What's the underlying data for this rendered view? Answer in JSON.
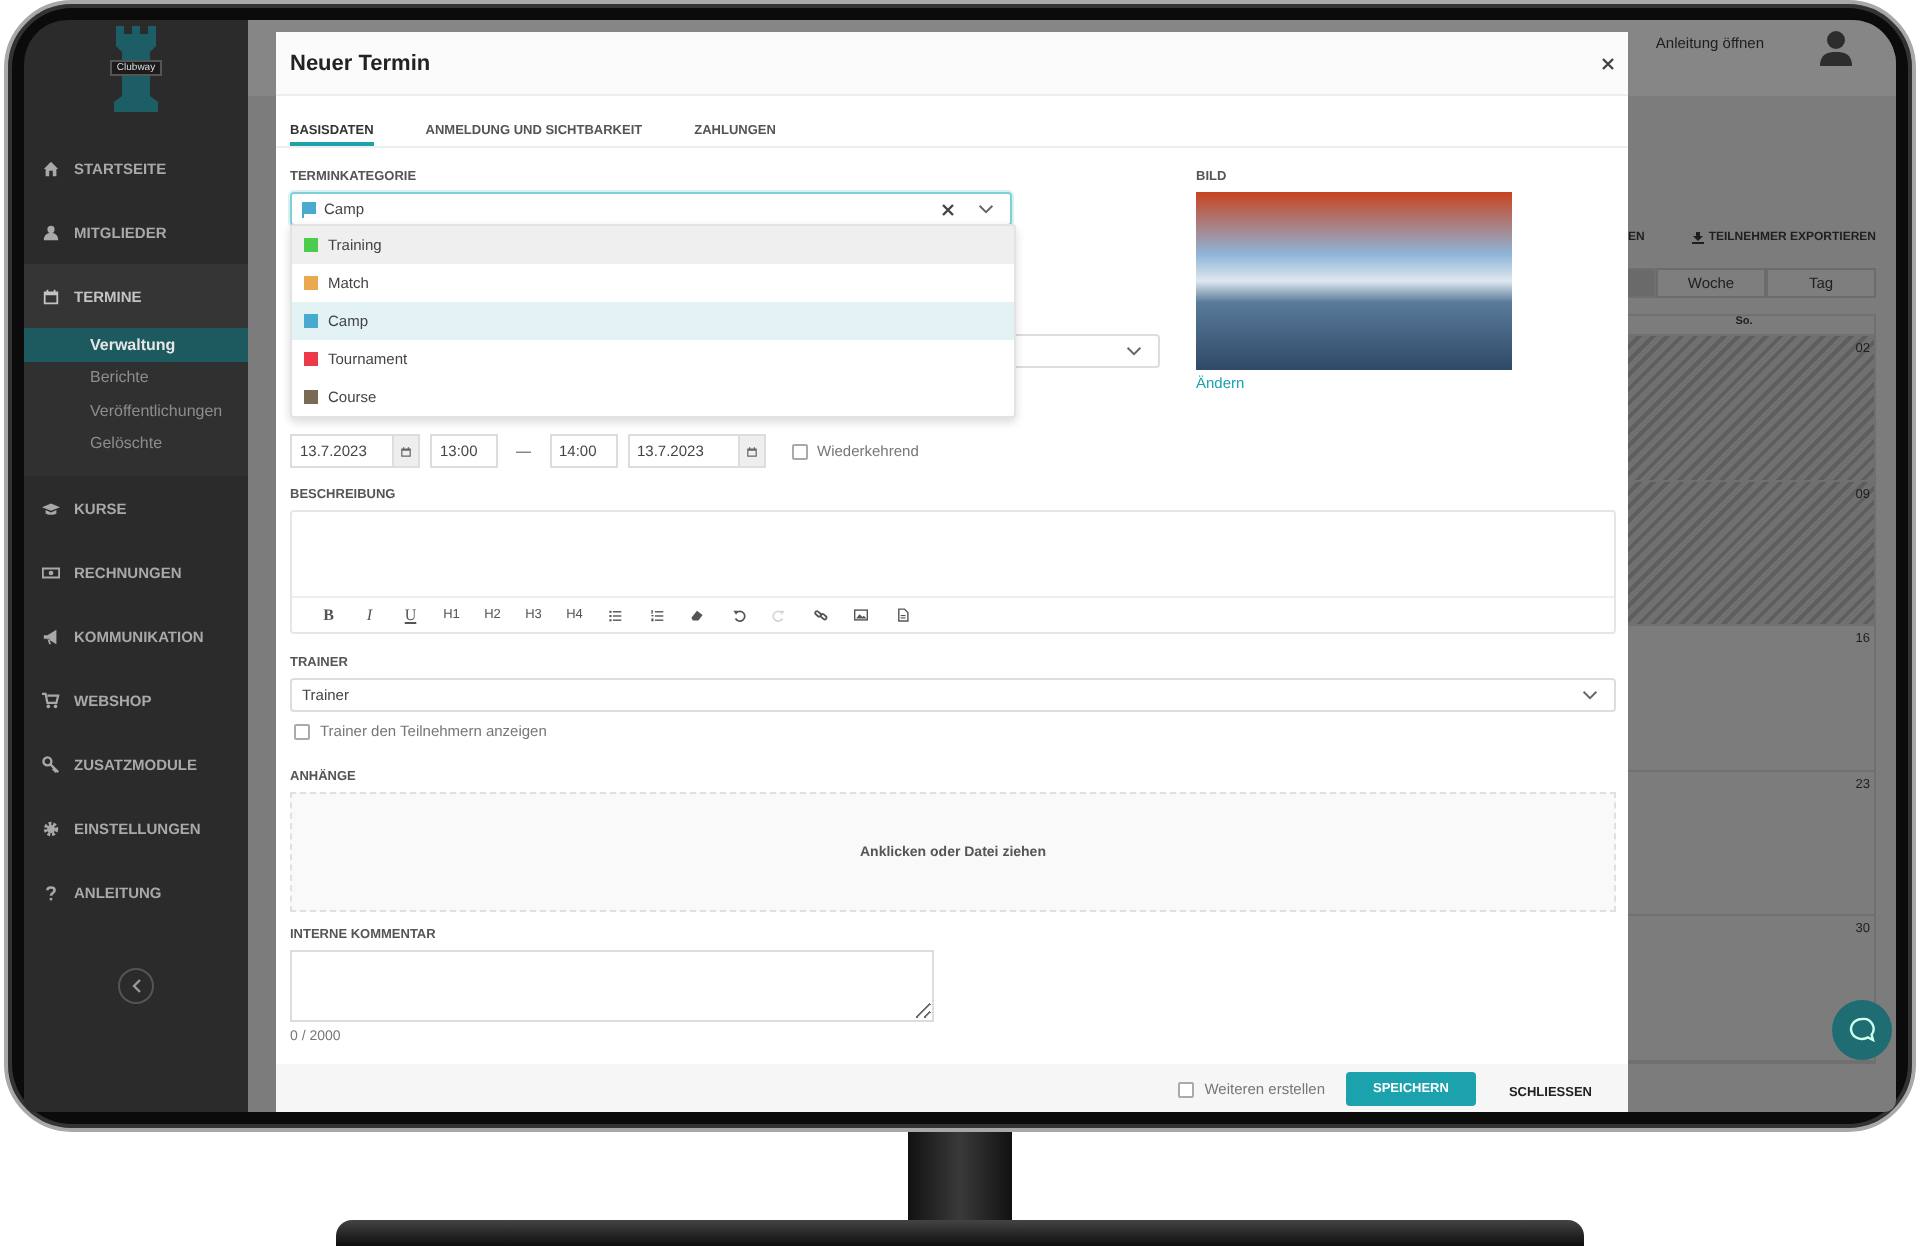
{
  "sidebar": {
    "logo_text": "Clubway",
    "items": [
      {
        "label": "STARTSEITE",
        "expanded": false
      },
      {
        "label": "MITGLIEDER",
        "expanded": false
      },
      {
        "label": "TERMINE",
        "expanded": true,
        "children": [
          {
            "label": "Verwaltung",
            "selected": true
          },
          {
            "label": "Berichte",
            "selected": false
          },
          {
            "label": "Veröffentlichungen",
            "selected": false
          },
          {
            "label": "Gelöschte",
            "selected": false
          }
        ]
      },
      {
        "label": "KURSE",
        "expanded": false
      },
      {
        "label": "RECHNUNGEN",
        "expanded": false
      },
      {
        "label": "KOMMUNIKATION",
        "expanded": false
      },
      {
        "label": "WEBSHOP",
        "expanded": false
      },
      {
        "label": "ZUSATZMODULE",
        "expanded": false
      },
      {
        "label": "EINSTELLUNGEN",
        "expanded": false
      },
      {
        "label": "ANLEITUNG",
        "expanded": false
      }
    ]
  },
  "topbar": {
    "help_link": "Anleitung öffnen"
  },
  "background": {
    "toolbar": [
      "EN",
      "TEILNEHMER EXPORTIEREN"
    ],
    "views": [
      {
        "label": "Woche",
        "selected": false
      },
      {
        "label": "Tag",
        "selected": false
      }
    ],
    "calendar": {
      "column": "So.",
      "days": [
        {
          "label": "02",
          "past": true
        },
        {
          "label": "09",
          "past": true
        },
        {
          "label": "16",
          "past": false
        },
        {
          "label": "23",
          "past": false
        },
        {
          "label": "30",
          "past": false
        }
      ]
    }
  },
  "dialog": {
    "title": "Neuer Termin",
    "tabs": [
      {
        "label": "BASISDATEN",
        "selected": true
      },
      {
        "label": "ANMELDUNG UND SICHTBARKEIT",
        "selected": false
      },
      {
        "label": "ZAHLUNGEN",
        "selected": false
      }
    ],
    "category": {
      "label": "TERMINKATEGORIE",
      "value": "Camp",
      "color": "#4aa9cf",
      "options": [
        {
          "label": "Training",
          "color": "#4ccc4c",
          "selected": false,
          "hovered": true
        },
        {
          "label": "Match",
          "color": "#eaa94e",
          "selected": false,
          "hovered": false
        },
        {
          "label": "Camp",
          "color": "#4aa9cf",
          "selected": true,
          "hovered": false
        },
        {
          "label": "Tournament",
          "color": "#ec3a48",
          "selected": false,
          "hovered": false
        },
        {
          "label": "Course",
          "color": "#7a6a55",
          "selected": false,
          "hovered": false
        }
      ]
    },
    "image": {
      "label": "BILD",
      "link": "Ändern"
    },
    "dates": {
      "start_date": "13.7.2023",
      "start_time": "13:00",
      "dash": "—",
      "end_time": "14:00",
      "end_date": "13.7.2023",
      "recurring": {
        "label": "Wiederkehrend",
        "checked": false
      }
    },
    "description": {
      "label": "BESCHREIBUNG",
      "toolbar": [
        {
          "kind": "text",
          "label": "B",
          "disabled": false
        },
        {
          "kind": "text",
          "label": "I",
          "disabled": false
        },
        {
          "kind": "text",
          "label": "U",
          "disabled": false
        },
        {
          "kind": "text",
          "label": "H1",
          "disabled": false
        },
        {
          "kind": "text",
          "label": "H2",
          "disabled": false
        },
        {
          "kind": "text",
          "label": "H3",
          "disabled": false
        },
        {
          "kind": "text",
          "label": "H4",
          "disabled": false
        },
        {
          "kind": "icon",
          "disabled": false
        },
        {
          "kind": "icon",
          "disabled": false
        },
        {
          "kind": "icon",
          "disabled": false
        },
        {
          "kind": "icon",
          "disabled": false
        },
        {
          "kind": "icon",
          "disabled": true
        },
        {
          "kind": "icon",
          "disabled": false
        },
        {
          "kind": "icon",
          "disabled": false
        },
        {
          "kind": "icon",
          "disabled": false
        }
      ]
    },
    "trainer": {
      "label": "TRAINER",
      "placeholder": "Trainer",
      "show": {
        "label": "Trainer den Teilnehmern anzeigen",
        "checked": false
      }
    },
    "attachments": {
      "label": "ANHÄNGE",
      "dropzone": "Anklicken oder Datei ziehen"
    },
    "comment": {
      "label": "INTERNE KOMMENTAR",
      "counter": "0 / 2000"
    },
    "footer": {
      "another": {
        "label": "Weiteren erstellen",
        "checked": false
      },
      "save": "SPEICHERN",
      "close": "SCHLIESSEN"
    }
  }
}
